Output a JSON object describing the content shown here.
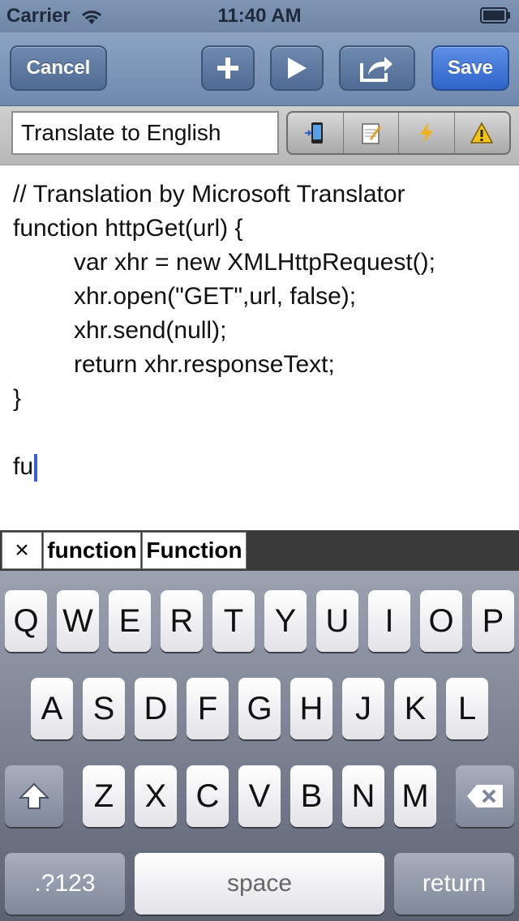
{
  "status_bar": {
    "carrier": "Carrier",
    "time": "11:40 AM"
  },
  "toolbar": {
    "cancel_label": "Cancel",
    "add_icon": "plus-icon",
    "run_icon": "play-icon",
    "share_icon": "share-icon",
    "save_label": "Save"
  },
  "title_field": {
    "value": "Translate to English"
  },
  "segment_icons": [
    "phone-icon",
    "notepad-icon",
    "lightning-icon",
    "warning-icon"
  ],
  "editor": {
    "lines": [
      "// Translation by Microsoft Translator",
      "function httpGet(url) {",
      "var xhr = new XMLHttpRequest();",
      "xhr.open(\"GET\",url, false);",
      "xhr.send(null);",
      "return xhr.responseText;",
      "}",
      "",
      "fu"
    ]
  },
  "suggestions": {
    "close": "×",
    "items": [
      "function",
      "Function"
    ]
  },
  "keyboard": {
    "row1": [
      "Q",
      "W",
      "E",
      "R",
      "T",
      "Y",
      "U",
      "I",
      "O",
      "P"
    ],
    "row2": [
      "A",
      "S",
      "D",
      "F",
      "G",
      "H",
      "J",
      "K",
      "L"
    ],
    "row3": [
      "Z",
      "X",
      "C",
      "V",
      "B",
      "N",
      "M"
    ],
    "numbers_key": ".?123",
    "space_key": "space",
    "return_key": "return"
  },
  "colors": {
    "toolbar_blue": "#6f89ad",
    "save_blue": "#2f65c9",
    "cursor": "#3a5fd0"
  }
}
